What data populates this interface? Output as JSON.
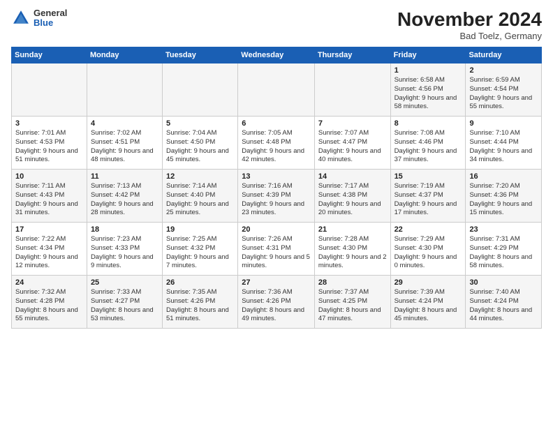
{
  "header": {
    "logo_general": "General",
    "logo_blue": "Blue",
    "month": "November 2024",
    "location": "Bad Toelz, Germany"
  },
  "days_of_week": [
    "Sunday",
    "Monday",
    "Tuesday",
    "Wednesday",
    "Thursday",
    "Friday",
    "Saturday"
  ],
  "weeks": [
    [
      {
        "day": "",
        "info": ""
      },
      {
        "day": "",
        "info": ""
      },
      {
        "day": "",
        "info": ""
      },
      {
        "day": "",
        "info": ""
      },
      {
        "day": "",
        "info": ""
      },
      {
        "day": "1",
        "info": "Sunrise: 6:58 AM\nSunset: 4:56 PM\nDaylight: 9 hours and 58 minutes."
      },
      {
        "day": "2",
        "info": "Sunrise: 6:59 AM\nSunset: 4:54 PM\nDaylight: 9 hours and 55 minutes."
      }
    ],
    [
      {
        "day": "3",
        "info": "Sunrise: 7:01 AM\nSunset: 4:53 PM\nDaylight: 9 hours and 51 minutes."
      },
      {
        "day": "4",
        "info": "Sunrise: 7:02 AM\nSunset: 4:51 PM\nDaylight: 9 hours and 48 minutes."
      },
      {
        "day": "5",
        "info": "Sunrise: 7:04 AM\nSunset: 4:50 PM\nDaylight: 9 hours and 45 minutes."
      },
      {
        "day": "6",
        "info": "Sunrise: 7:05 AM\nSunset: 4:48 PM\nDaylight: 9 hours and 42 minutes."
      },
      {
        "day": "7",
        "info": "Sunrise: 7:07 AM\nSunset: 4:47 PM\nDaylight: 9 hours and 40 minutes."
      },
      {
        "day": "8",
        "info": "Sunrise: 7:08 AM\nSunset: 4:46 PM\nDaylight: 9 hours and 37 minutes."
      },
      {
        "day": "9",
        "info": "Sunrise: 7:10 AM\nSunset: 4:44 PM\nDaylight: 9 hours and 34 minutes."
      }
    ],
    [
      {
        "day": "10",
        "info": "Sunrise: 7:11 AM\nSunset: 4:43 PM\nDaylight: 9 hours and 31 minutes."
      },
      {
        "day": "11",
        "info": "Sunrise: 7:13 AM\nSunset: 4:42 PM\nDaylight: 9 hours and 28 minutes."
      },
      {
        "day": "12",
        "info": "Sunrise: 7:14 AM\nSunset: 4:40 PM\nDaylight: 9 hours and 25 minutes."
      },
      {
        "day": "13",
        "info": "Sunrise: 7:16 AM\nSunset: 4:39 PM\nDaylight: 9 hours and 23 minutes."
      },
      {
        "day": "14",
        "info": "Sunrise: 7:17 AM\nSunset: 4:38 PM\nDaylight: 9 hours and 20 minutes."
      },
      {
        "day": "15",
        "info": "Sunrise: 7:19 AM\nSunset: 4:37 PM\nDaylight: 9 hours and 17 minutes."
      },
      {
        "day": "16",
        "info": "Sunrise: 7:20 AM\nSunset: 4:36 PM\nDaylight: 9 hours and 15 minutes."
      }
    ],
    [
      {
        "day": "17",
        "info": "Sunrise: 7:22 AM\nSunset: 4:34 PM\nDaylight: 9 hours and 12 minutes."
      },
      {
        "day": "18",
        "info": "Sunrise: 7:23 AM\nSunset: 4:33 PM\nDaylight: 9 hours and 9 minutes."
      },
      {
        "day": "19",
        "info": "Sunrise: 7:25 AM\nSunset: 4:32 PM\nDaylight: 9 hours and 7 minutes."
      },
      {
        "day": "20",
        "info": "Sunrise: 7:26 AM\nSunset: 4:31 PM\nDaylight: 9 hours and 5 minutes."
      },
      {
        "day": "21",
        "info": "Sunrise: 7:28 AM\nSunset: 4:30 PM\nDaylight: 9 hours and 2 minutes."
      },
      {
        "day": "22",
        "info": "Sunrise: 7:29 AM\nSunset: 4:30 PM\nDaylight: 9 hours and 0 minutes."
      },
      {
        "day": "23",
        "info": "Sunrise: 7:31 AM\nSunset: 4:29 PM\nDaylight: 8 hours and 58 minutes."
      }
    ],
    [
      {
        "day": "24",
        "info": "Sunrise: 7:32 AM\nSunset: 4:28 PM\nDaylight: 8 hours and 55 minutes."
      },
      {
        "day": "25",
        "info": "Sunrise: 7:33 AM\nSunset: 4:27 PM\nDaylight: 8 hours and 53 minutes."
      },
      {
        "day": "26",
        "info": "Sunrise: 7:35 AM\nSunset: 4:26 PM\nDaylight: 8 hours and 51 minutes."
      },
      {
        "day": "27",
        "info": "Sunrise: 7:36 AM\nSunset: 4:26 PM\nDaylight: 8 hours and 49 minutes."
      },
      {
        "day": "28",
        "info": "Sunrise: 7:37 AM\nSunset: 4:25 PM\nDaylight: 8 hours and 47 minutes."
      },
      {
        "day": "29",
        "info": "Sunrise: 7:39 AM\nSunset: 4:24 PM\nDaylight: 8 hours and 45 minutes."
      },
      {
        "day": "30",
        "info": "Sunrise: 7:40 AM\nSunset: 4:24 PM\nDaylight: 8 hours and 44 minutes."
      }
    ]
  ]
}
